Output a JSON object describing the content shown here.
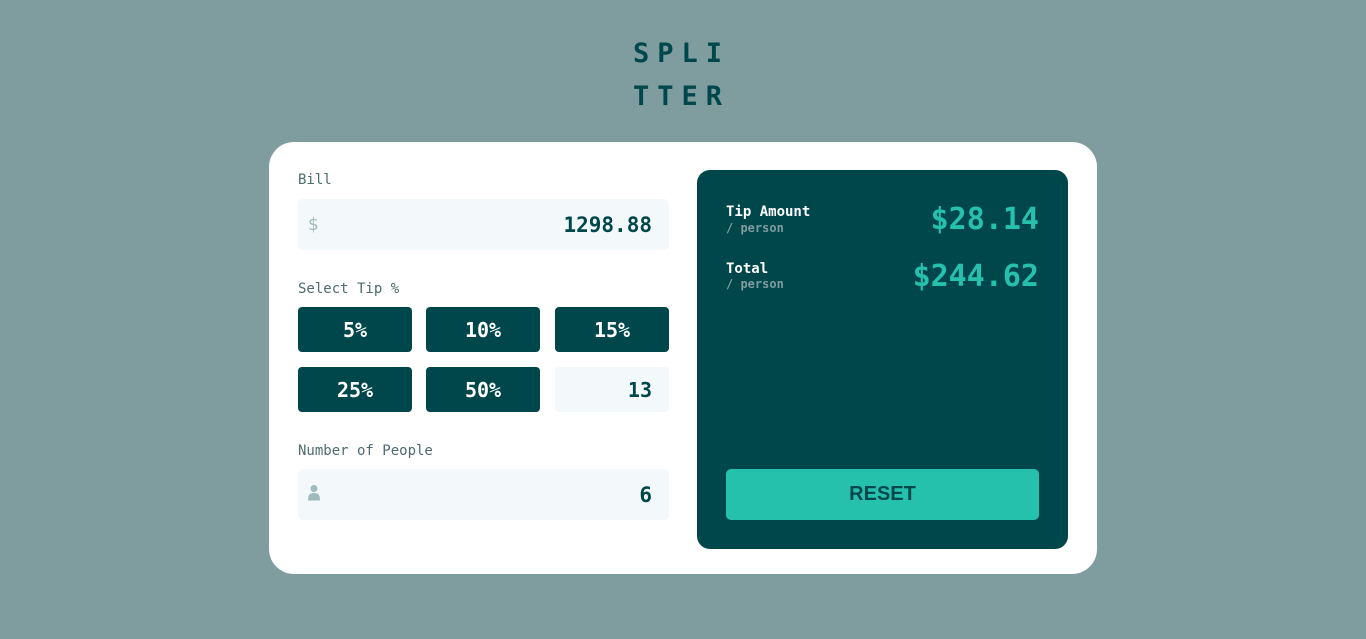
{
  "app": {
    "logo_line1": "SPLI",
    "logo_line2": "TTER"
  },
  "bill": {
    "label": "Bill",
    "currency_icon": "$",
    "value": "1298.88"
  },
  "tip": {
    "label": "Select Tip %",
    "options": [
      "5%",
      "10%",
      "15%",
      "25%",
      "50%"
    ],
    "custom_value": "13"
  },
  "people": {
    "label": "Number of People",
    "icon": "person-icon",
    "value": "6"
  },
  "results": {
    "tip_label": "Tip Amount",
    "tip_sub": "/ person",
    "tip_value": "$28.14",
    "total_label": "Total",
    "total_sub": "/ person",
    "total_value": "$244.62",
    "reset_label": "RESET"
  },
  "colors": {
    "background": "#7f9d9f",
    "primary_dark": "#00474b",
    "accent": "#26c1ad",
    "input_bg": "#f3f8fb"
  }
}
